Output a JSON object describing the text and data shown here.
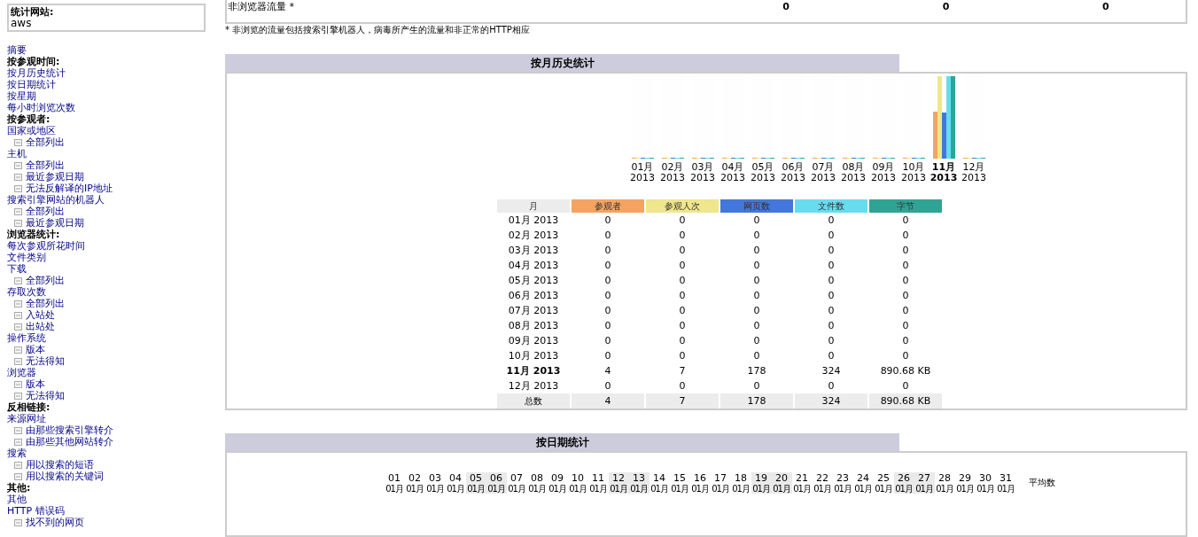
{
  "sidebar": {
    "site_label": "统计网站:",
    "site": "aws",
    "items": [
      {
        "kind": "link",
        "label": "摘要"
      },
      {
        "kind": "heading",
        "label": "按参观时间:"
      },
      {
        "kind": "link",
        "label": "按月历史统计"
      },
      {
        "kind": "link",
        "label": "按日期统计"
      },
      {
        "kind": "link",
        "label": "按星期"
      },
      {
        "kind": "link",
        "label": "每小时浏览次数"
      },
      {
        "kind": "heading",
        "label": "按参观者:"
      },
      {
        "kind": "link",
        "label": "国家或地区",
        "children": [
          {
            "label": "全部列出"
          }
        ]
      },
      {
        "kind": "link",
        "label": "主机",
        "children": [
          {
            "label": "全部列出"
          },
          {
            "label": "最近参观日期"
          },
          {
            "label": "无法反解译的IP地址"
          }
        ]
      },
      {
        "kind": "link",
        "label": "搜索引擎网站的机器人",
        "children": [
          {
            "label": "全部列出"
          },
          {
            "label": "最近参观日期"
          }
        ]
      },
      {
        "kind": "heading",
        "label": "浏览器统计:"
      },
      {
        "kind": "link",
        "label": "每次参观所花时间"
      },
      {
        "kind": "link",
        "label": "文件类别"
      },
      {
        "kind": "link",
        "label": "下载",
        "children": [
          {
            "label": "全部列出"
          }
        ]
      },
      {
        "kind": "link",
        "label": "存取次数",
        "children": [
          {
            "label": "全部列出"
          },
          {
            "label": "入站处"
          },
          {
            "label": "出站处"
          }
        ]
      },
      {
        "kind": "link",
        "label": "操作系统",
        "children": [
          {
            "label": "版本"
          },
          {
            "label": "无法得知"
          }
        ]
      },
      {
        "kind": "link",
        "label": "浏览器",
        "children": [
          {
            "label": "版本"
          },
          {
            "label": "无法得知"
          }
        ]
      },
      {
        "kind": "heading",
        "label": "反相链接:"
      },
      {
        "kind": "link",
        "label": "来源网址",
        "children": [
          {
            "label": "由那些搜索引擎转介"
          },
          {
            "label": "由那些其他网站转介"
          }
        ]
      },
      {
        "kind": "link",
        "label": "搜索",
        "children": [
          {
            "label": "用以搜索的短语"
          },
          {
            "label": "用以搜索的关键词"
          }
        ]
      },
      {
        "kind": "heading",
        "label": "其他:"
      },
      {
        "kind": "link",
        "label": "其他"
      },
      {
        "kind": "link",
        "label": "HTTP 错误码",
        "children": [
          {
            "label": "找不到的网页"
          }
        ]
      }
    ]
  },
  "traffic_row": {
    "label": "非浏览器流量 *",
    "cells": [
      "0",
      "0",
      "0"
    ]
  },
  "footnote": "* 非浏览的流量包括搜索引擎机器人，病毒所产生的流量和非正常的HTTP相应",
  "monthly": {
    "title": "按月历史统计",
    "columns": [
      {
        "label": "月",
        "color": "#ececec"
      },
      {
        "label": "参观者",
        "color": "#f4a460"
      },
      {
        "label": "参观人次",
        "color": "#f0e68c"
      },
      {
        "label": "网页数",
        "color": "#4477dd"
      },
      {
        "label": "文件数",
        "color": "#66ddee"
      },
      {
        "label": "字节",
        "color": "#2ea495"
      }
    ],
    "chart": [
      {
        "month": "01月",
        "year": "2013",
        "current": false,
        "bars": [
          {
            "level": 0
          },
          {
            "level": 0
          },
          {
            "level": 0
          },
          {
            "level": 0
          },
          {
            "level": 0
          }
        ]
      },
      {
        "month": "02月",
        "year": "2013",
        "current": false,
        "bars": [
          {
            "level": 0
          },
          {
            "level": 0
          },
          {
            "level": 0
          },
          {
            "level": 0
          },
          {
            "level": 0
          }
        ]
      },
      {
        "month": "03月",
        "year": "2013",
        "current": false,
        "bars": [
          {
            "level": 0
          },
          {
            "level": 0
          },
          {
            "level": 0
          },
          {
            "level": 0
          },
          {
            "level": 0
          }
        ]
      },
      {
        "month": "04月",
        "year": "2013",
        "current": false,
        "bars": [
          {
            "level": 0
          },
          {
            "level": 0
          },
          {
            "level": 0
          },
          {
            "level": 0
          },
          {
            "level": 0
          }
        ]
      },
      {
        "month": "05月",
        "year": "2013",
        "current": false,
        "bars": [
          {
            "level": 0
          },
          {
            "level": 0
          },
          {
            "level": 0
          },
          {
            "level": 0
          },
          {
            "level": 0
          }
        ]
      },
      {
        "month": "06月",
        "year": "2013",
        "current": false,
        "bars": [
          {
            "level": 0
          },
          {
            "level": 0
          },
          {
            "level": 0
          },
          {
            "level": 0
          },
          {
            "level": 0
          }
        ]
      },
      {
        "month": "07月",
        "year": "2013",
        "current": false,
        "bars": [
          {
            "level": 0
          },
          {
            "level": 0
          },
          {
            "level": 0
          },
          {
            "level": 0
          },
          {
            "level": 0
          }
        ]
      },
      {
        "month": "08月",
        "year": "2013",
        "current": false,
        "bars": [
          {
            "level": 0
          },
          {
            "level": 0
          },
          {
            "level": 0
          },
          {
            "level": 0
          },
          {
            "level": 0
          }
        ]
      },
      {
        "month": "09月",
        "year": "2013",
        "current": false,
        "bars": [
          {
            "level": 0
          },
          {
            "level": 0
          },
          {
            "level": 0
          },
          {
            "level": 0
          },
          {
            "level": 0
          }
        ]
      },
      {
        "month": "10月",
        "year": "2013",
        "current": false,
        "bars": [
          {
            "level": 0
          },
          {
            "level": 0
          },
          {
            "level": 0
          },
          {
            "level": 0
          },
          {
            "level": 0
          }
        ]
      },
      {
        "month": "11月",
        "year": "2013",
        "current": true,
        "bars": [
          {
            "level": 0.57
          },
          {
            "level": 1
          },
          {
            "level": 0.55
          },
          {
            "level": 1
          },
          {
            "level": 1
          }
        ]
      },
      {
        "month": "12月",
        "year": "2013",
        "current": false,
        "bars": [
          {
            "level": 0
          },
          {
            "level": 0
          },
          {
            "level": 0
          },
          {
            "level": 0
          },
          {
            "level": 0
          }
        ]
      }
    ],
    "rows": [
      {
        "month": "01月 2013",
        "current": false,
        "values": [
          "0",
          "0",
          "0",
          "0",
          "0"
        ]
      },
      {
        "month": "02月 2013",
        "current": false,
        "values": [
          "0",
          "0",
          "0",
          "0",
          "0"
        ]
      },
      {
        "month": "03月 2013",
        "current": false,
        "values": [
          "0",
          "0",
          "0",
          "0",
          "0"
        ]
      },
      {
        "month": "04月 2013",
        "current": false,
        "values": [
          "0",
          "0",
          "0",
          "0",
          "0"
        ]
      },
      {
        "month": "05月 2013",
        "current": false,
        "values": [
          "0",
          "0",
          "0",
          "0",
          "0"
        ]
      },
      {
        "month": "06月 2013",
        "current": false,
        "values": [
          "0",
          "0",
          "0",
          "0",
          "0"
        ]
      },
      {
        "month": "07月 2013",
        "current": false,
        "values": [
          "0",
          "0",
          "0",
          "0",
          "0"
        ]
      },
      {
        "month": "08月 2013",
        "current": false,
        "values": [
          "0",
          "0",
          "0",
          "0",
          "0"
        ]
      },
      {
        "month": "09月 2013",
        "current": false,
        "values": [
          "0",
          "0",
          "0",
          "0",
          "0"
        ]
      },
      {
        "month": "10月 2013",
        "current": false,
        "values": [
          "0",
          "0",
          "0",
          "0",
          "0"
        ]
      },
      {
        "month": "11月 2013",
        "current": true,
        "values": [
          "4",
          "7",
          "178",
          "324",
          "890.68 KB"
        ]
      },
      {
        "month": "12月 2013",
        "current": false,
        "values": [
          "0",
          "0",
          "0",
          "0",
          "0"
        ]
      }
    ],
    "total": {
      "label": "总数",
      "values": [
        "4",
        "7",
        "178",
        "324",
        "890.68 KB"
      ]
    }
  },
  "daily": {
    "title": "按日期统计",
    "average": "平均数",
    "days": [
      {
        "day": "01",
        "month": "01月",
        "weekend": false
      },
      {
        "day": "02",
        "month": "01月",
        "weekend": false
      },
      {
        "day": "03",
        "month": "01月",
        "weekend": false
      },
      {
        "day": "04",
        "month": "01月",
        "weekend": false
      },
      {
        "day": "05",
        "month": "01月",
        "weekend": true
      },
      {
        "day": "06",
        "month": "01月",
        "weekend": true
      },
      {
        "day": "07",
        "month": "01月",
        "weekend": false
      },
      {
        "day": "08",
        "month": "01月",
        "weekend": false
      },
      {
        "day": "09",
        "month": "01月",
        "weekend": false
      },
      {
        "day": "10",
        "month": "01月",
        "weekend": false
      },
      {
        "day": "11",
        "month": "01月",
        "weekend": false
      },
      {
        "day": "12",
        "month": "01月",
        "weekend": true
      },
      {
        "day": "13",
        "month": "01月",
        "weekend": true
      },
      {
        "day": "14",
        "month": "01月",
        "weekend": false
      },
      {
        "day": "15",
        "month": "01月",
        "weekend": false
      },
      {
        "day": "16",
        "month": "01月",
        "weekend": false
      },
      {
        "day": "17",
        "month": "01月",
        "weekend": false
      },
      {
        "day": "18",
        "month": "01月",
        "weekend": false
      },
      {
        "day": "19",
        "month": "01月",
        "weekend": true
      },
      {
        "day": "20",
        "month": "01月",
        "weekend": true
      },
      {
        "day": "21",
        "month": "01月",
        "weekend": false
      },
      {
        "day": "22",
        "month": "01月",
        "weekend": false
      },
      {
        "day": "23",
        "month": "01月",
        "weekend": false
      },
      {
        "day": "24",
        "month": "01月",
        "weekend": false
      },
      {
        "day": "25",
        "month": "01月",
        "weekend": false
      },
      {
        "day": "26",
        "month": "01月",
        "weekend": true
      },
      {
        "day": "27",
        "month": "01月",
        "weekend": true
      },
      {
        "day": "28",
        "month": "01月",
        "weekend": false
      },
      {
        "day": "29",
        "month": "01月",
        "weekend": false
      },
      {
        "day": "30",
        "month": "01月",
        "weekend": false
      },
      {
        "day": "31",
        "month": "01月",
        "weekend": false
      }
    ]
  }
}
